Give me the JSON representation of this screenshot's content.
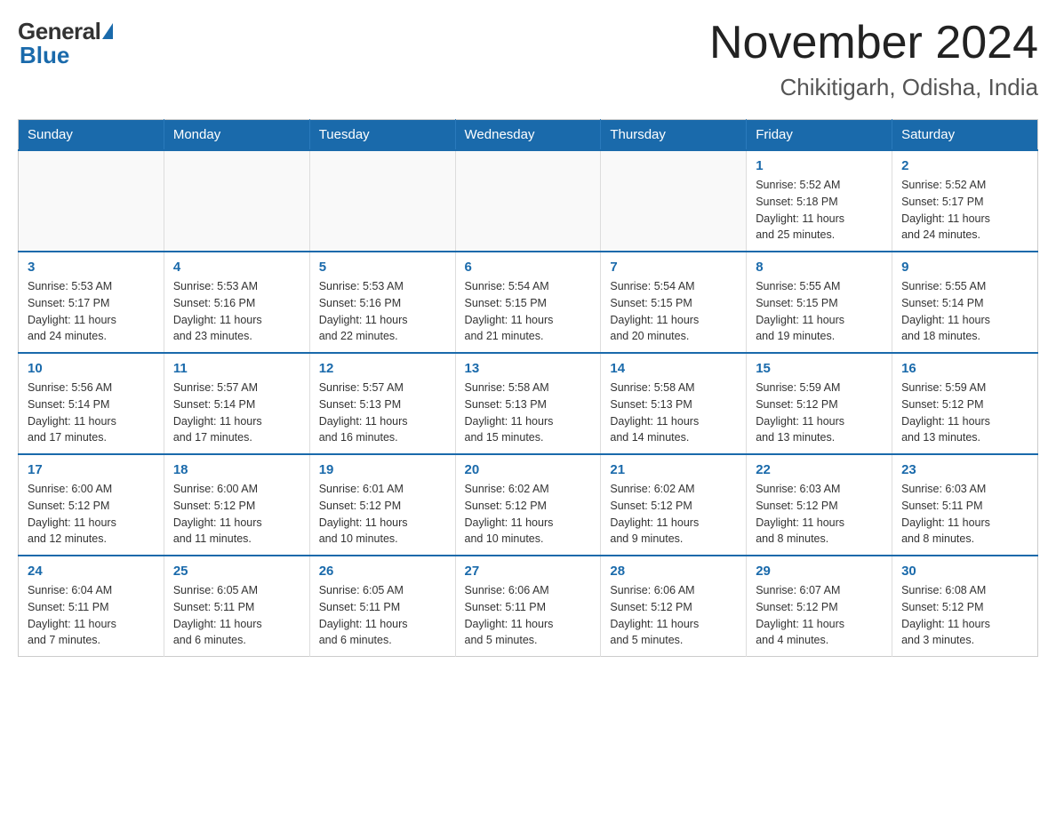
{
  "logo": {
    "general": "General",
    "blue": "Blue"
  },
  "title": "November 2024",
  "subtitle": "Chikitigarh, Odisha, India",
  "days_of_week": [
    "Sunday",
    "Monday",
    "Tuesday",
    "Wednesday",
    "Thursday",
    "Friday",
    "Saturday"
  ],
  "weeks": [
    [
      {
        "day": "",
        "info": ""
      },
      {
        "day": "",
        "info": ""
      },
      {
        "day": "",
        "info": ""
      },
      {
        "day": "",
        "info": ""
      },
      {
        "day": "",
        "info": ""
      },
      {
        "day": "1",
        "info": "Sunrise: 5:52 AM\nSunset: 5:18 PM\nDaylight: 11 hours\nand 25 minutes."
      },
      {
        "day": "2",
        "info": "Sunrise: 5:52 AM\nSunset: 5:17 PM\nDaylight: 11 hours\nand 24 minutes."
      }
    ],
    [
      {
        "day": "3",
        "info": "Sunrise: 5:53 AM\nSunset: 5:17 PM\nDaylight: 11 hours\nand 24 minutes."
      },
      {
        "day": "4",
        "info": "Sunrise: 5:53 AM\nSunset: 5:16 PM\nDaylight: 11 hours\nand 23 minutes."
      },
      {
        "day": "5",
        "info": "Sunrise: 5:53 AM\nSunset: 5:16 PM\nDaylight: 11 hours\nand 22 minutes."
      },
      {
        "day": "6",
        "info": "Sunrise: 5:54 AM\nSunset: 5:15 PM\nDaylight: 11 hours\nand 21 minutes."
      },
      {
        "day": "7",
        "info": "Sunrise: 5:54 AM\nSunset: 5:15 PM\nDaylight: 11 hours\nand 20 minutes."
      },
      {
        "day": "8",
        "info": "Sunrise: 5:55 AM\nSunset: 5:15 PM\nDaylight: 11 hours\nand 19 minutes."
      },
      {
        "day": "9",
        "info": "Sunrise: 5:55 AM\nSunset: 5:14 PM\nDaylight: 11 hours\nand 18 minutes."
      }
    ],
    [
      {
        "day": "10",
        "info": "Sunrise: 5:56 AM\nSunset: 5:14 PM\nDaylight: 11 hours\nand 17 minutes."
      },
      {
        "day": "11",
        "info": "Sunrise: 5:57 AM\nSunset: 5:14 PM\nDaylight: 11 hours\nand 17 minutes."
      },
      {
        "day": "12",
        "info": "Sunrise: 5:57 AM\nSunset: 5:13 PM\nDaylight: 11 hours\nand 16 minutes."
      },
      {
        "day": "13",
        "info": "Sunrise: 5:58 AM\nSunset: 5:13 PM\nDaylight: 11 hours\nand 15 minutes."
      },
      {
        "day": "14",
        "info": "Sunrise: 5:58 AM\nSunset: 5:13 PM\nDaylight: 11 hours\nand 14 minutes."
      },
      {
        "day": "15",
        "info": "Sunrise: 5:59 AM\nSunset: 5:12 PM\nDaylight: 11 hours\nand 13 minutes."
      },
      {
        "day": "16",
        "info": "Sunrise: 5:59 AM\nSunset: 5:12 PM\nDaylight: 11 hours\nand 13 minutes."
      }
    ],
    [
      {
        "day": "17",
        "info": "Sunrise: 6:00 AM\nSunset: 5:12 PM\nDaylight: 11 hours\nand 12 minutes."
      },
      {
        "day": "18",
        "info": "Sunrise: 6:00 AM\nSunset: 5:12 PM\nDaylight: 11 hours\nand 11 minutes."
      },
      {
        "day": "19",
        "info": "Sunrise: 6:01 AM\nSunset: 5:12 PM\nDaylight: 11 hours\nand 10 minutes."
      },
      {
        "day": "20",
        "info": "Sunrise: 6:02 AM\nSunset: 5:12 PM\nDaylight: 11 hours\nand 10 minutes."
      },
      {
        "day": "21",
        "info": "Sunrise: 6:02 AM\nSunset: 5:12 PM\nDaylight: 11 hours\nand 9 minutes."
      },
      {
        "day": "22",
        "info": "Sunrise: 6:03 AM\nSunset: 5:12 PM\nDaylight: 11 hours\nand 8 minutes."
      },
      {
        "day": "23",
        "info": "Sunrise: 6:03 AM\nSunset: 5:11 PM\nDaylight: 11 hours\nand 8 minutes."
      }
    ],
    [
      {
        "day": "24",
        "info": "Sunrise: 6:04 AM\nSunset: 5:11 PM\nDaylight: 11 hours\nand 7 minutes."
      },
      {
        "day": "25",
        "info": "Sunrise: 6:05 AM\nSunset: 5:11 PM\nDaylight: 11 hours\nand 6 minutes."
      },
      {
        "day": "26",
        "info": "Sunrise: 6:05 AM\nSunset: 5:11 PM\nDaylight: 11 hours\nand 6 minutes."
      },
      {
        "day": "27",
        "info": "Sunrise: 6:06 AM\nSunset: 5:11 PM\nDaylight: 11 hours\nand 5 minutes."
      },
      {
        "day": "28",
        "info": "Sunrise: 6:06 AM\nSunset: 5:12 PM\nDaylight: 11 hours\nand 5 minutes."
      },
      {
        "day": "29",
        "info": "Sunrise: 6:07 AM\nSunset: 5:12 PM\nDaylight: 11 hours\nand 4 minutes."
      },
      {
        "day": "30",
        "info": "Sunrise: 6:08 AM\nSunset: 5:12 PM\nDaylight: 11 hours\nand 3 minutes."
      }
    ]
  ]
}
